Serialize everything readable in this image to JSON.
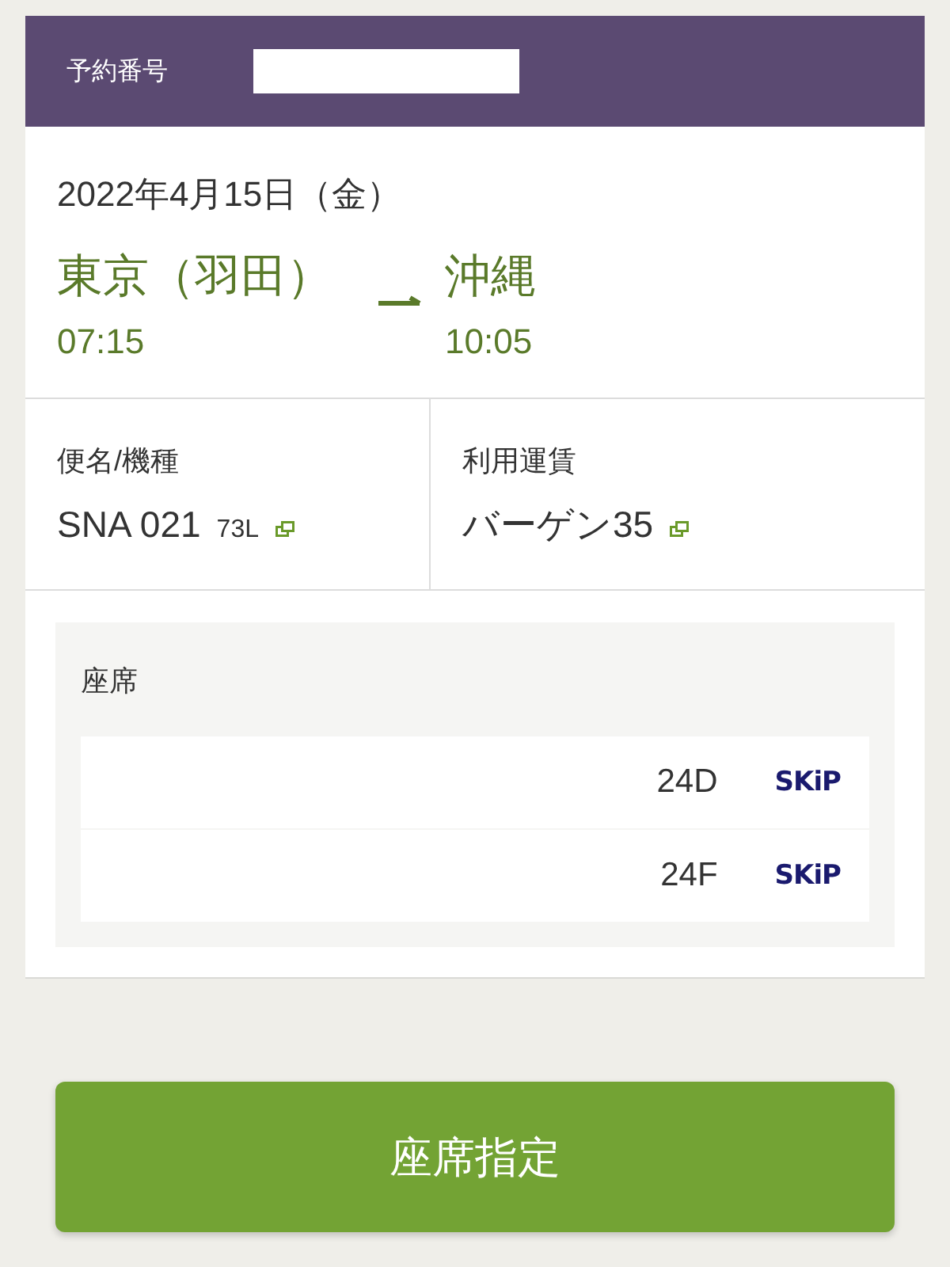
{
  "reservation": {
    "label": "予約番号",
    "redacted": true
  },
  "flight": {
    "date": "2022年4月15日（金）",
    "origin": {
      "city": "東京（羽田）",
      "time": "07:15"
    },
    "destination": {
      "city": "沖縄",
      "time": "10:05"
    }
  },
  "details": [
    {
      "label": "便名/機種",
      "value": "SNA 021",
      "sub": "73L",
      "link": true
    },
    {
      "label": "利用運賃",
      "value": "バーゲン35",
      "link": true
    }
  ],
  "seats": {
    "title": "座席",
    "rows": [
      {
        "seat": "24D",
        "badge": "SKiP"
      },
      {
        "seat": "24F",
        "badge": "SKiP"
      }
    ]
  },
  "primary_button": "座席指定"
}
